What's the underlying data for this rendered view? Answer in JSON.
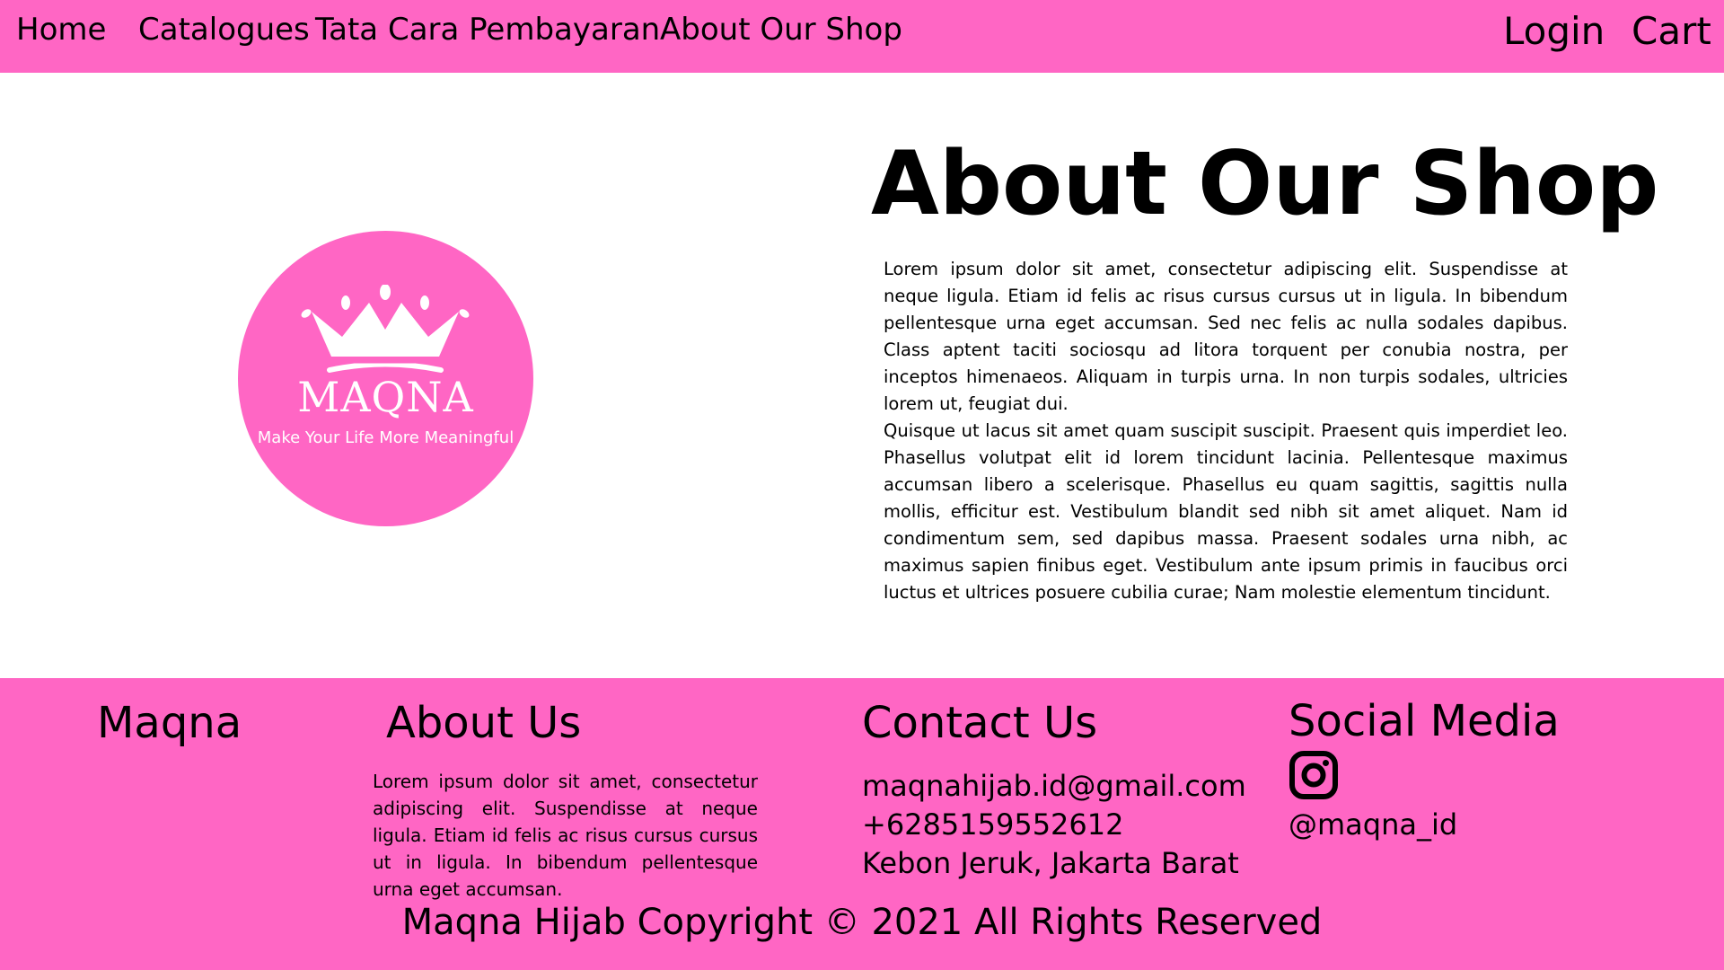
{
  "colors": {
    "brand_pink": "#ff66c4",
    "text": "#000000",
    "logo_text": "#ffffff"
  },
  "navbar": {
    "links": [
      "Home",
      "Catalogues",
      "Tata Cara Pembayaran",
      "About Our Shop"
    ],
    "login": "Login",
    "cart": "Cart"
  },
  "logo": {
    "icon": "crown-icon",
    "name": "MAQNA",
    "tagline": "Make Your Life More Meaningful"
  },
  "about": {
    "title": "About Our Shop",
    "paragraphs": [
      "Lorem ipsum dolor sit amet, consectetur adipiscing elit. Suspendisse at neque ligula. Etiam id felis ac risus cursus cursus ut in ligula. In bibendum pellentesque urna eget accumsan. Sed nec felis ac nulla sodales dapibus. Class aptent taciti sociosqu ad litora torquent per conubia nostra, per inceptos himenaeos. Aliquam in turpis urna. In non turpis sodales, ultricies lorem ut, feugiat dui.",
      "Quisque ut lacus sit amet quam suscipit suscipit. Praesent quis imperdiet leo. Phasellus volutpat elit id lorem tincidunt lacinia. Pellentesque maximus accumsan libero a scelerisque. Phasellus eu quam sagittis, sagittis nulla mollis, efficitur est. Vestibulum blandit sed nibh sit amet aliquet. Nam id condimentum sem, sed dapibus massa. Praesent sodales urna nibh, ac maximus sapien finibus eget. Vestibulum ante ipsum primis in faucibus orci luctus et ultrices posuere cubilia curae; Nam molestie elementum tincidunt."
    ]
  },
  "footer": {
    "brand": "Maqna",
    "about_heading": "About Us",
    "about_text": "Lorem ipsum dolor sit amet, consectetur adipiscing elit. Suspendisse at neque ligula. Etiam id felis ac risus cursus cursus ut in ligula. In bibendum pellentesque urna eget accumsan.",
    "contact_heading": "Contact Us",
    "email": "maqnahijab.id@gmail.com",
    "phone": "+6285159552612",
    "address": "Kebon Jeruk, Jakarta Barat",
    "social_heading": "Social Media",
    "social_icon": "instagram-icon",
    "instagram_handle": "@maqna_id",
    "copyright": "Maqna Hijab Copyright © 2021 All Rights Reserved"
  }
}
